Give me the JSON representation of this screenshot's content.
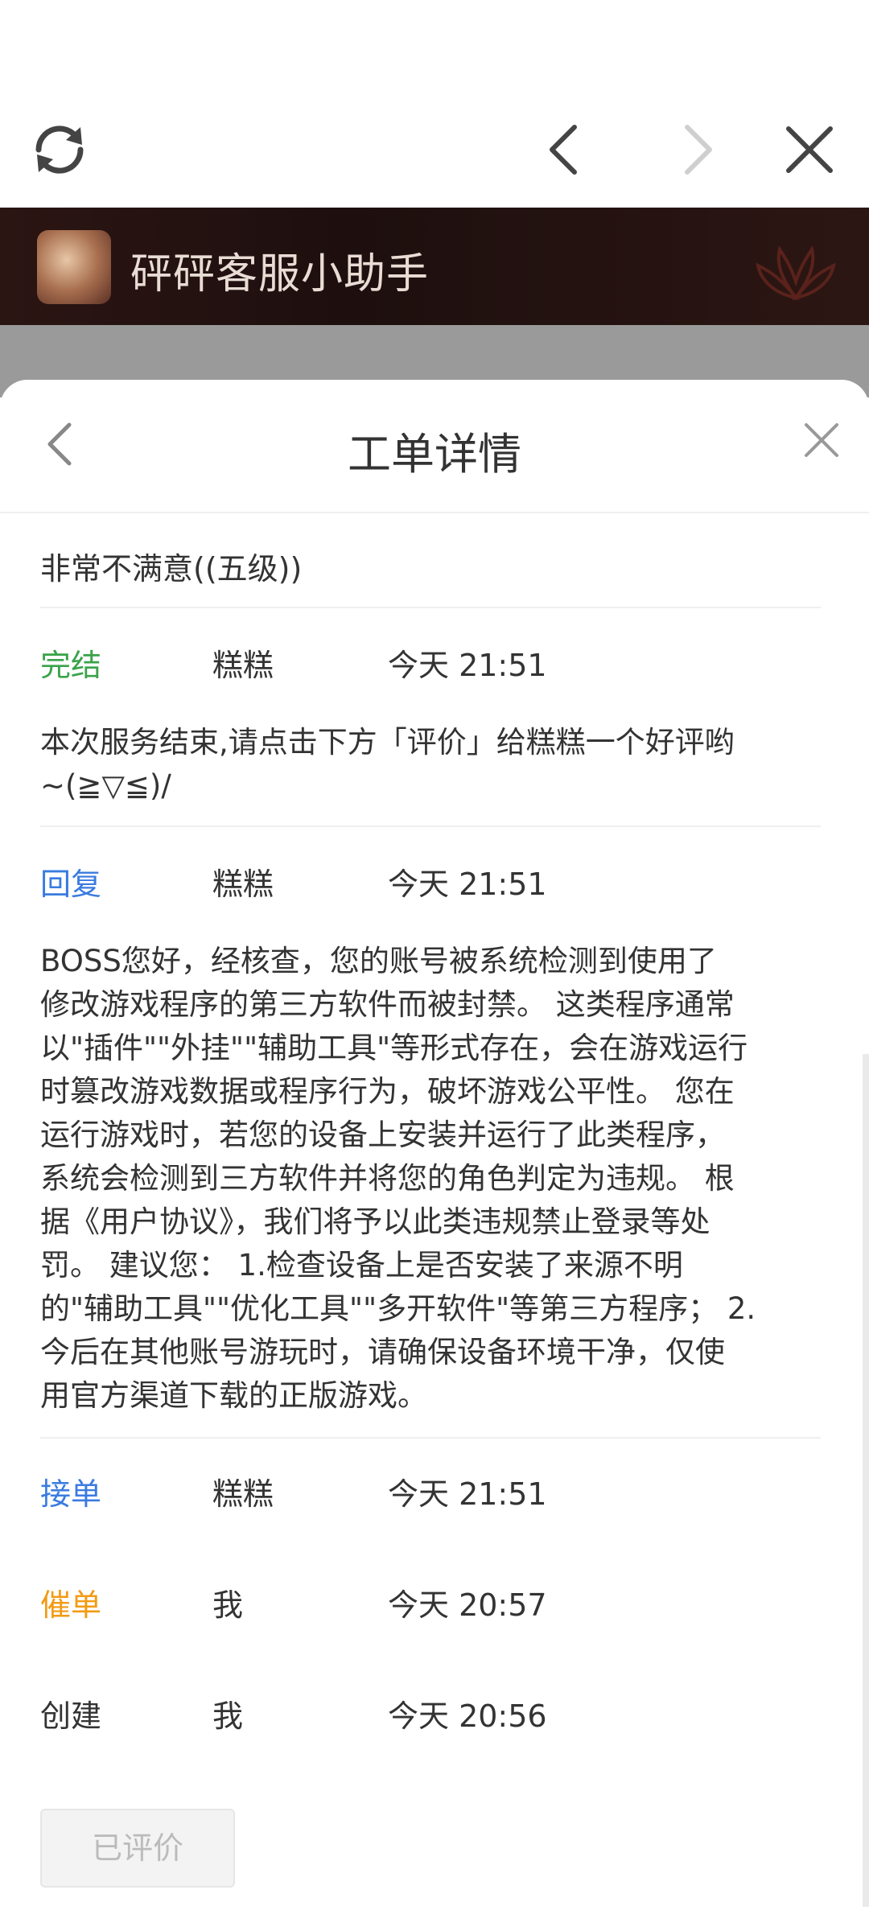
{
  "topbar": {
    "icons": [
      "refresh-icon",
      "chevron-left-icon",
      "chevron-right-icon",
      "close-icon"
    ]
  },
  "header": {
    "title": "砰砰客服小助手"
  },
  "sheet": {
    "title": "工单详情"
  },
  "rating": {
    "text": "非常不满意((五级))"
  },
  "events": [
    {
      "status": "完结",
      "color": "#3aa34a",
      "person": "糕糕",
      "time": "今天 21:51"
    },
    {
      "status": "回复",
      "color": "#3a7be0",
      "person": "糕糕",
      "time": "今天 21:51"
    },
    {
      "status": "接单",
      "color": "#3a7be0",
      "person": "糕糕",
      "time": "今天 21:51"
    },
    {
      "status": "催单",
      "color": "#f29b13",
      "person": "我",
      "time": "今天 20:57"
    },
    {
      "status": "创建",
      "color": "#333333",
      "person": "我",
      "time": "今天 20:56"
    }
  ],
  "messages": {
    "complete_line1": "本次服务结束,请点击下方「评价」给糕糕一个好评哟",
    "complete_line2": "~(≧▽≦)/",
    "reply_lines": [
      "BOSS您好，经核查，您的账号被系统检测到使用了",
      "修改游戏程序的第三方软件而被封禁。 这类程序通常",
      "以\"插件\"\"外挂\"\"辅助工具\"等形式存在，会在游戏运行",
      "时篡改游戏数据或程序行为，破坏游戏公平性。 您在",
      "运行游戏时，若您的设备上安装并运行了此类程序，",
      "系统会检测到三方软件并将您的角色判定为违规。 根",
      "据《用户协议》，我们将予以此类违规禁止登录等处",
      "罚。 建议您： 1.检查设备上是否安装了来源不明",
      "的\"辅助工具\"\"优化工具\"\"多开软件\"等第三方程序； 2.",
      "今后在其他账号游玩时，请确保设备环境干净，仅使",
      "用官方渠道下载的正版游戏。"
    ]
  },
  "actions": {
    "rated_label": "已评价"
  }
}
